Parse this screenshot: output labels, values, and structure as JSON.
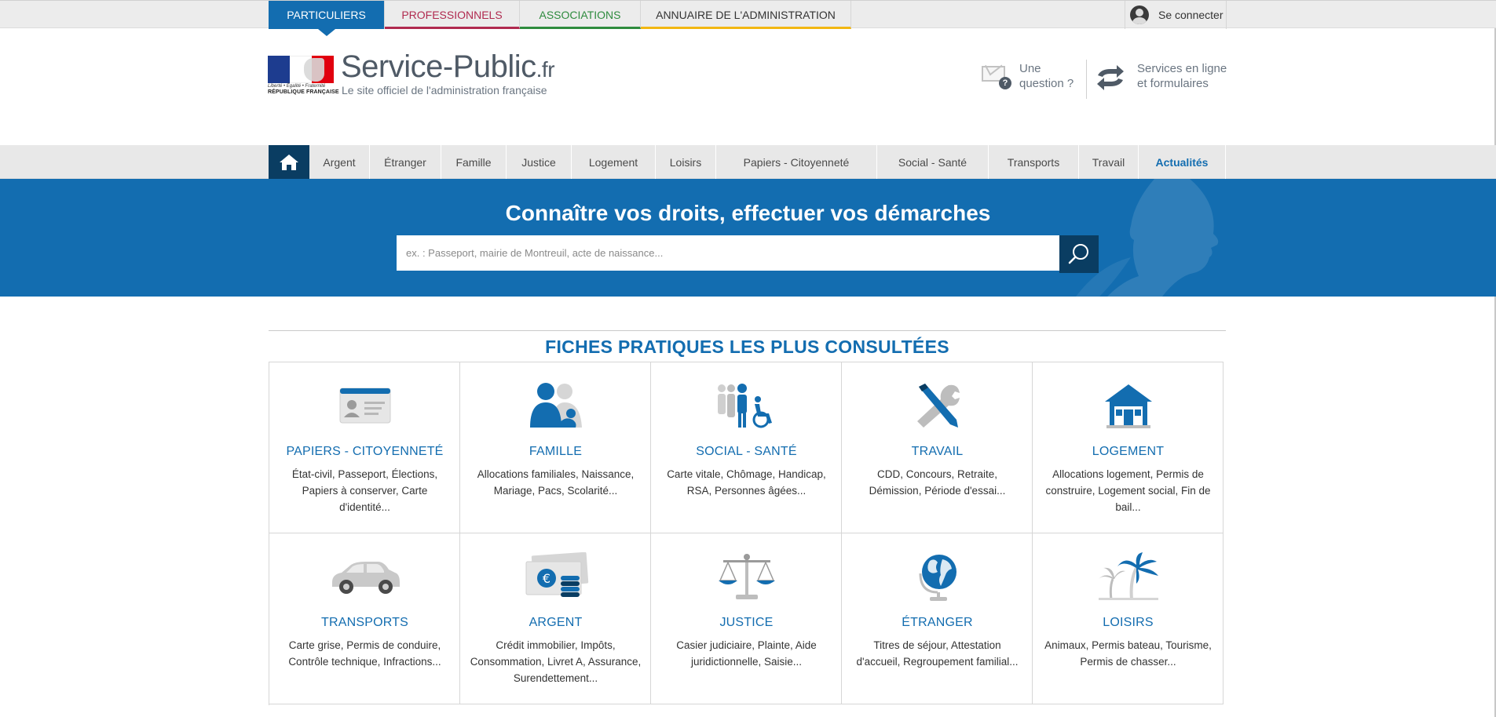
{
  "audience_tabs": [
    {
      "label": "PARTICULIERS"
    },
    {
      "label": "PROFESSIONNELS"
    },
    {
      "label": "ASSOCIATIONS"
    },
    {
      "label": "ANNUAIRE DE L'ADMINISTRATION"
    }
  ],
  "login": {
    "label": "Se connecter"
  },
  "brand": {
    "name": "Service-Public",
    "tld": ".fr",
    "tagline": "Le site officiel de l'administration française",
    "motto": "Liberté • Égalité • Fraternité",
    "republic": "RÉPUBLIQUE FRANÇAISE"
  },
  "quick_links": {
    "question": {
      "line1": "Une",
      "line2": "question ?"
    },
    "services": {
      "line1": "Services en ligne",
      "line2": "et formulaires"
    }
  },
  "nav": {
    "items": [
      {
        "label": "Argent"
      },
      {
        "label": "Étranger"
      },
      {
        "label": "Famille"
      },
      {
        "label": "Justice"
      },
      {
        "label": "Logement"
      },
      {
        "label": "Loisirs"
      },
      {
        "label": "Papiers - Citoyenneté"
      },
      {
        "label": "Social - Santé"
      },
      {
        "label": "Transports"
      },
      {
        "label": "Travail"
      },
      {
        "label": "Actualités"
      }
    ]
  },
  "hero": {
    "title": "Connaître vos droits, effectuer vos démarches",
    "search_placeholder": "ex. : Passeport, mairie de Montreuil, acte de naissance..."
  },
  "section": {
    "title": "FICHES PRATIQUES LES PLUS CONSULTÉES"
  },
  "cards": [
    {
      "title": "PAPIERS - CITOYENNETÉ",
      "desc": "État-civil, Passeport, Élections, Papiers à conserver, Carte d'identité...",
      "icon": "id-card-icon"
    },
    {
      "title": "FAMILLE",
      "desc": "Allocations familiales, Naissance, Mariage, Pacs, Scolarité...",
      "icon": "family-icon"
    },
    {
      "title": "SOCIAL - SANTÉ",
      "desc": "Carte vitale, Chômage, Handicap, RSA, Personnes âgées...",
      "icon": "people-wheelchair-icon"
    },
    {
      "title": "TRAVAIL",
      "desc": "CDD, Concours, Retraite, Démission, Période d'essai...",
      "icon": "tools-pen-icon"
    },
    {
      "title": "LOGEMENT",
      "desc": "Allocations logement, Permis de construire, Logement social, Fin de bail...",
      "icon": "house-icon"
    },
    {
      "title": "TRANSPORTS",
      "desc": "Carte grise, Permis de conduire, Contrôle technique, Infractions...",
      "icon": "car-icon"
    },
    {
      "title": "ARGENT",
      "desc": "Crédit immobilier, Impôts, Consommation, Livret A, Assurance, Surendettement...",
      "icon": "money-icon"
    },
    {
      "title": "JUSTICE",
      "desc": "Casier judiciaire, Plainte, Aide juridictionnelle, Saisie...",
      "icon": "scales-icon"
    },
    {
      "title": "ÉTRANGER",
      "desc": "Titres de séjour, Attestation d'accueil, Regroupement familial...",
      "icon": "globe-icon"
    },
    {
      "title": "LOISIRS",
      "desc": "Animaux, Permis bateau, Tourisme, Permis de chasser...",
      "icon": "palm-trees-icon"
    }
  ],
  "colors": {
    "primary_blue": "#136db0",
    "dark_blue": "#0a3d62",
    "pro_red": "#b02a4f",
    "asso_green": "#2e8b3e",
    "annuaire_yellow": "#f2b712"
  }
}
